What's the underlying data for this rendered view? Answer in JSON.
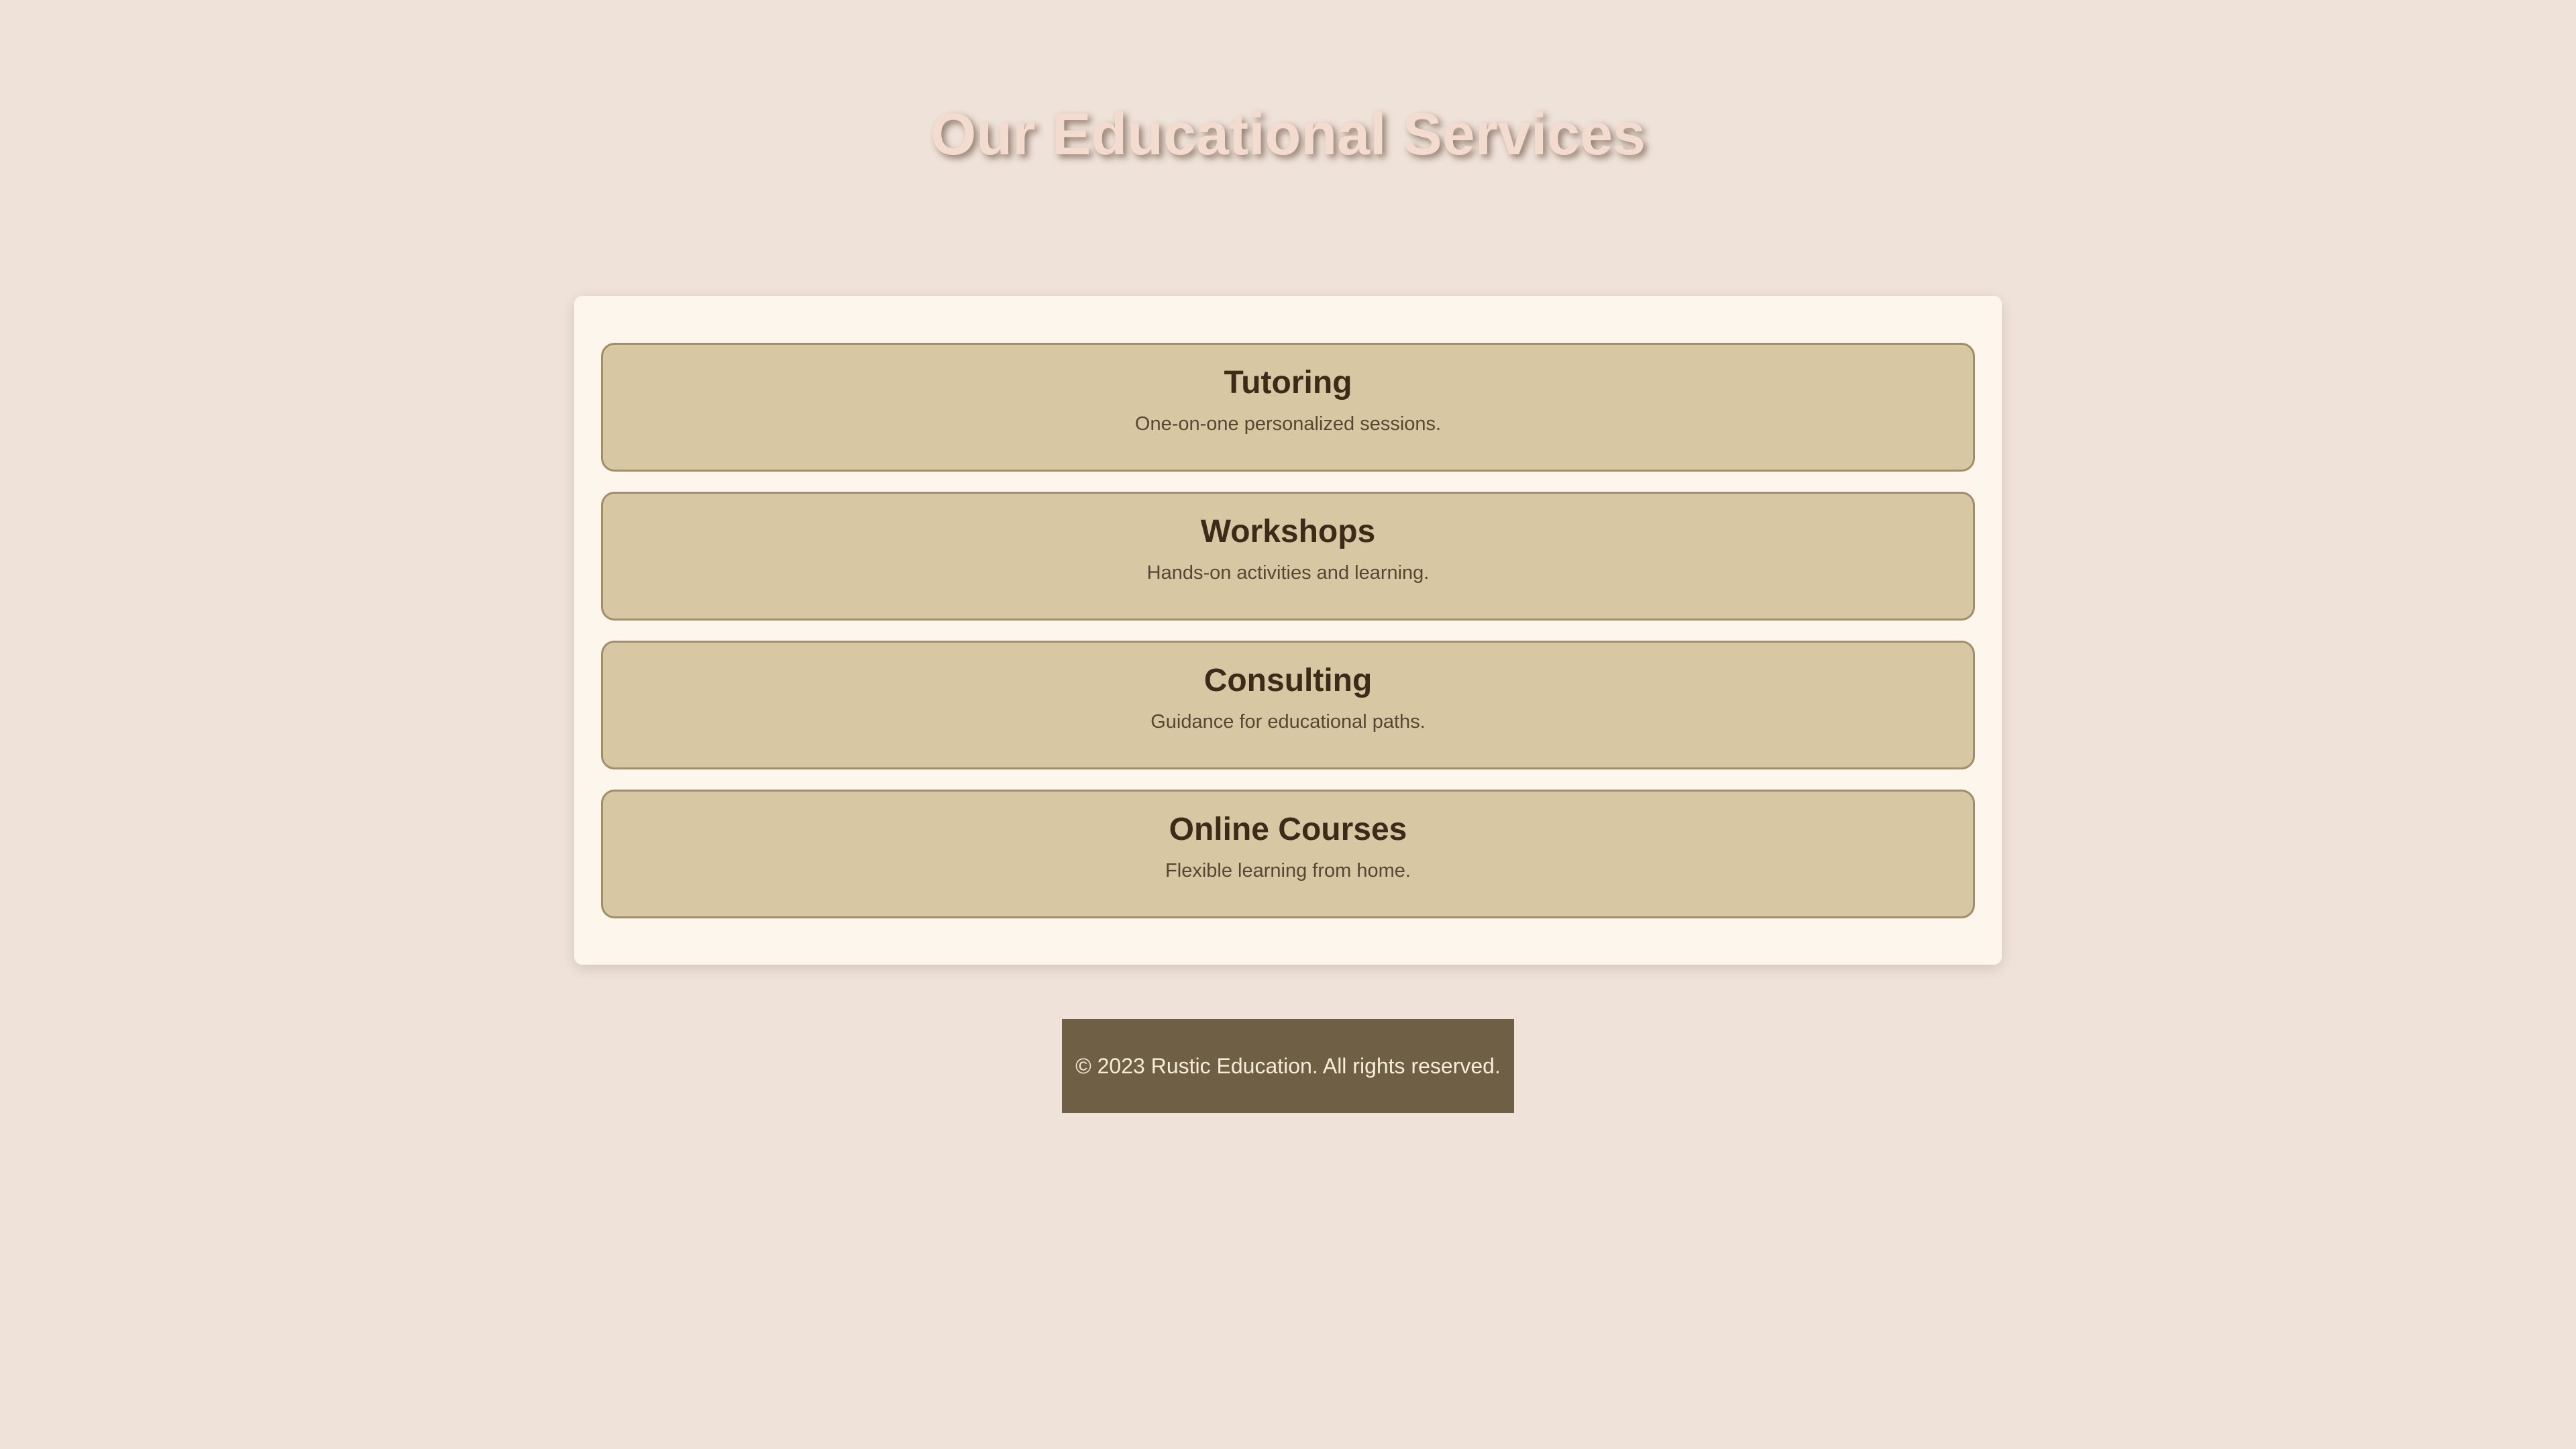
{
  "page": {
    "title": "Our Educational Services"
  },
  "services": [
    {
      "name": "Tutoring",
      "description": "One-on-one personalized sessions."
    },
    {
      "name": "Workshops",
      "description": "Hands-on activities and learning."
    },
    {
      "name": "Consulting",
      "description": "Guidance for educational paths."
    },
    {
      "name": "Online Courses",
      "description": "Flexible learning from home."
    }
  ],
  "footer": {
    "text": "© 2023 Rustic Education. All rights reserved."
  },
  "colors": {
    "background": "#efe2d8",
    "panel": "#fdf6ec",
    "card": "#d7c8a3",
    "card_border": "#a08d6c",
    "heading_text": "#3e2a18",
    "footer_bg": "#6f5f45",
    "title_text": "#f3dccf"
  }
}
